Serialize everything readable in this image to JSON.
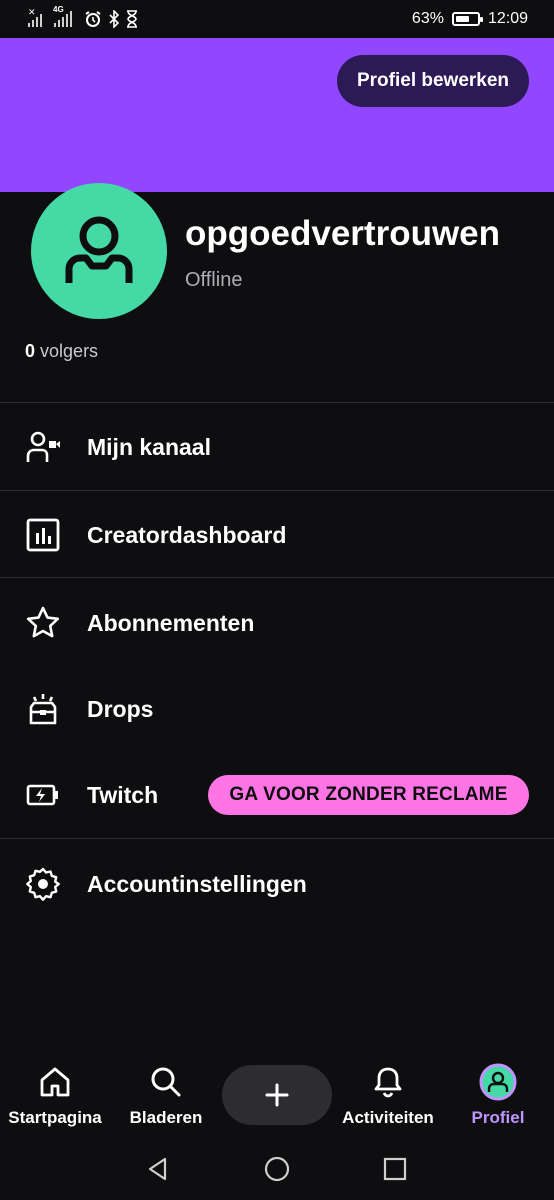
{
  "status_bar": {
    "network_type": "4G",
    "battery_percent": "63%",
    "battery_level": 0.63,
    "time": "12:09"
  },
  "header": {
    "edit_profile_label": "Profiel bewerken",
    "banner_color": "#9147ff"
  },
  "profile": {
    "username": "opgoedvertrouwen",
    "status": "Offline",
    "followers_count": "0",
    "followers_label": "volgers",
    "avatar_color": "#45d9a5"
  },
  "menu": {
    "items": [
      {
        "label": "Mijn kanaal",
        "icon": "channel-icon"
      },
      {
        "label": "Creatordashboard",
        "icon": "dashboard-icon"
      },
      {
        "label": "Abonnementen",
        "icon": "star-icon"
      },
      {
        "label": "Drops",
        "icon": "drops-icon"
      },
      {
        "label": "Twitch",
        "icon": "turbo-icon",
        "badge": "GA VOOR ZONDER RECLAME"
      },
      {
        "label": "Accountinstellingen",
        "icon": "gear-icon"
      }
    ]
  },
  "bottom_nav": {
    "items": [
      {
        "label": "Startpagina",
        "icon": "home-icon"
      },
      {
        "label": "Bladeren",
        "icon": "search-icon"
      },
      {
        "label": "Activiteiten",
        "icon": "bell-icon"
      },
      {
        "label": "Profiel",
        "icon": "avatar-icon",
        "active": true
      }
    ],
    "active_color": "#bf94ff"
  },
  "colors": {
    "background": "#0e0e10",
    "promo": "#ff75e6",
    "edit_button": "#2b1a56"
  }
}
